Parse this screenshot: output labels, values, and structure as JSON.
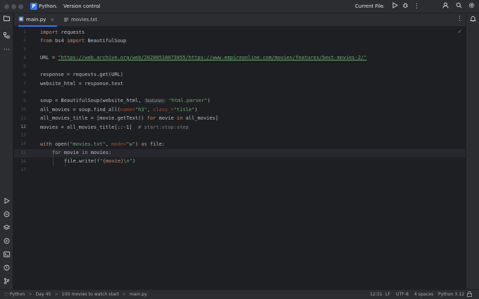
{
  "titlebar": {
    "project_name": "Python",
    "project_badge": "P",
    "vcs_label": "Version control",
    "run_config": "Current File"
  },
  "tabs": [
    {
      "label": "main.py",
      "active": true,
      "close": "×"
    },
    {
      "label": "movies.txt",
      "active": false
    }
  ],
  "editor": {
    "line_numbers": [
      "1",
      "2",
      "3",
      "4",
      "5",
      "6",
      "7",
      "8",
      "9",
      "10",
      "11",
      "12",
      "13",
      "14",
      "15",
      "16",
      "17"
    ],
    "current_line": 12,
    "lines": {
      "l1": {
        "kw1": "import",
        "rest": " requests"
      },
      "l2": {
        "kw1": "from",
        "mod": " bs4 ",
        "kw2": "import",
        "rest": " BeautifulSoup"
      },
      "l4": {
        "a": "URL = ",
        "url": "\"https://web.archive.org/web/20200518073855/https://www.empireonline.com/movies/features/best-movies-2/\""
      },
      "l6": {
        "text": "response = requests.get(URL)"
      },
      "l7": {
        "text": "website_html = response.text"
      },
      "l9": {
        "a": "soup = BeautifulSoup(website_html, ",
        "hint": "features:",
        "str": " \"html.parser\"",
        "b": ")"
      },
      "l10": {
        "a": "all_movies = soup.find_all(",
        "p1": "name=",
        "s1": "\"h3\"",
        "c": ", ",
        "p2": "class_=",
        "s2": "\"title\"",
        "b": ")"
      },
      "l11": {
        "a": "all_movies_title = [movie.getText() ",
        "k1": "for",
        "b": " movie ",
        "k2": "in",
        "c": " all_movies]"
      },
      "l12": {
        "a": "movies = all_movies_title[::-1]  ",
        "cmt": "# start:stop:step"
      },
      "l14": {
        "k1": "with",
        "a": " open(",
        "s1": "\"movies.txt\"",
        "b": ", ",
        "p": "mode=",
        "s2": "\"w\"",
        "c": ") ",
        "k2": "as",
        "d": " file:"
      },
      "l15": {
        "k1": "for",
        "a": " movie ",
        "k2": "in",
        "b": " movies:"
      },
      "l16": {
        "a": "file.write(",
        "s": "f\"",
        "b": "{movie}",
        "s2": "\\n\"",
        "c": ")"
      }
    },
    "inspection_icon": "✓"
  },
  "statusbar": {
    "breadcrumbs": [
      "Python",
      "Day 45",
      "100 movies to watch start",
      "main.py"
    ],
    "separator": ">",
    "position": "12:51",
    "line_ending": "LF",
    "encoding": "UTF-8",
    "indent": "4 spaces",
    "interpreter": "Python 3.12"
  },
  "colors": {
    "accent": "#3574f0",
    "keyword": "#cf8e6d",
    "string": "#6aab73",
    "parameter": "#aa4926",
    "comment": "#7a7e85",
    "background": "#1e1f22",
    "chrome": "#2b2d30"
  }
}
